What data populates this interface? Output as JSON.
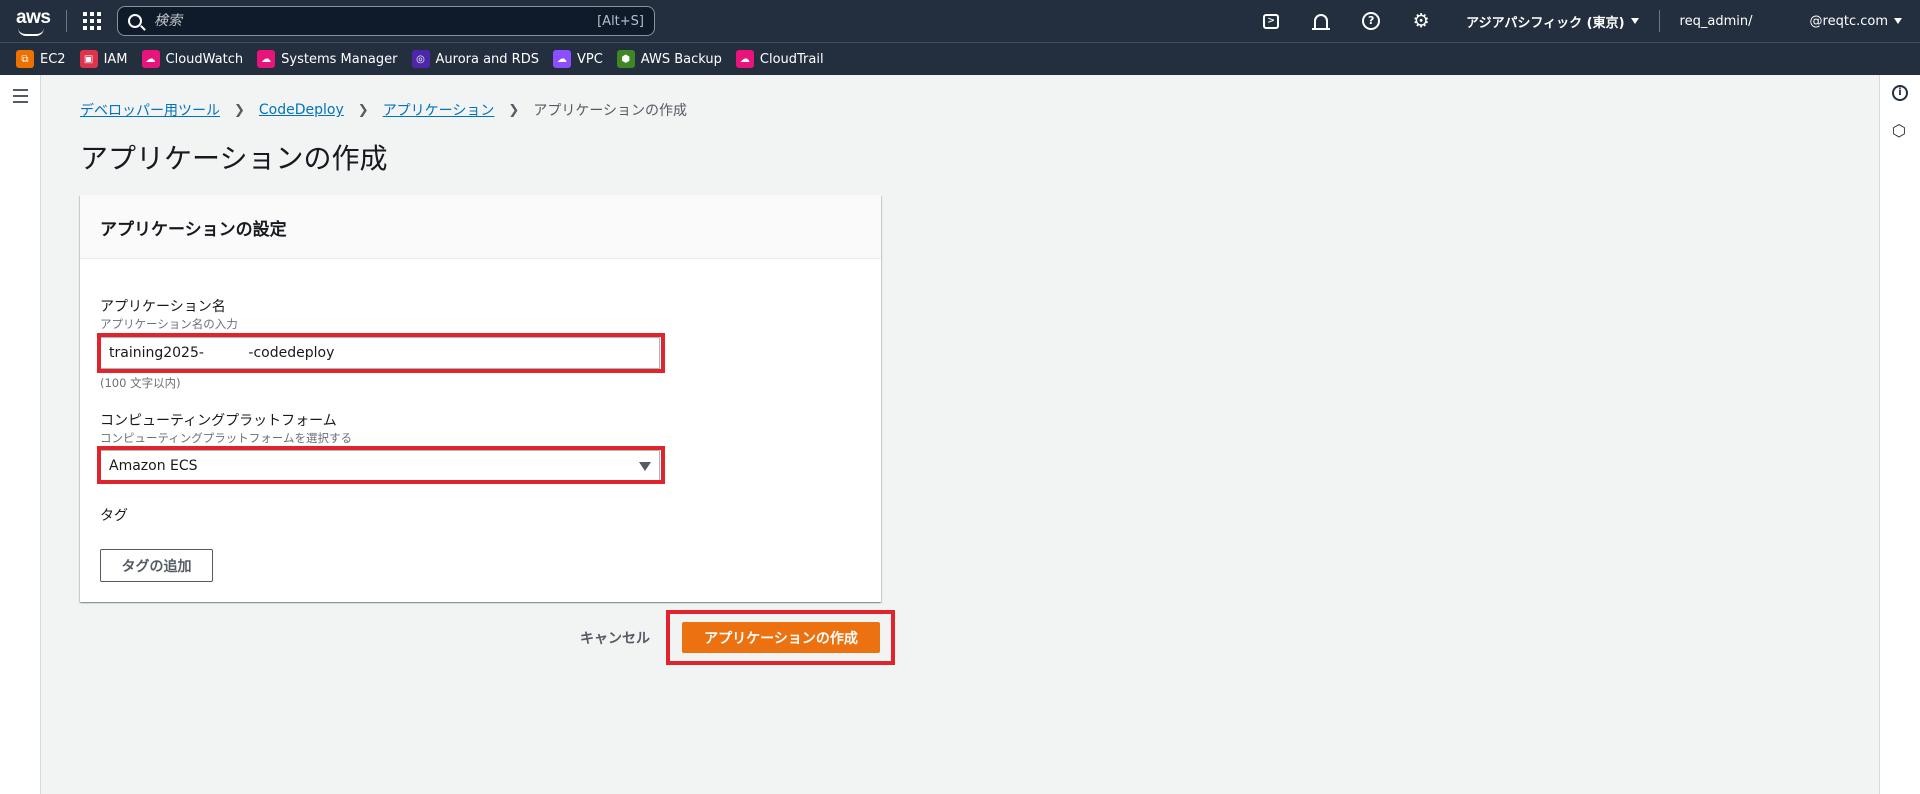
{
  "topnav": {
    "logo": "aws",
    "search_placeholder": "検索",
    "search_shortcut": "[Alt+S]",
    "region": "アジアパシフィック (東京)",
    "user": "req_admin/",
    "account": "@reqtc.com",
    "icons": [
      "cloudshell-icon",
      "bell-icon",
      "help-icon",
      "gear-icon"
    ]
  },
  "favorites": [
    {
      "label": "EC2",
      "color": "#ed7100"
    },
    {
      "label": "IAM",
      "color": "#dd344c"
    },
    {
      "label": "CloudWatch",
      "color": "#e7157b"
    },
    {
      "label": "Systems Manager",
      "color": "#e7157b"
    },
    {
      "label": "Aurora and RDS",
      "color": "#4d27aa"
    },
    {
      "label": "VPC",
      "color": "#8c4fff"
    },
    {
      "label": "AWS Backup",
      "color": "#3f8624"
    },
    {
      "label": "CloudTrail",
      "color": "#e7157b"
    }
  ],
  "breadcrumb": {
    "items": [
      "デベロッパー用ツール",
      "CodeDeploy",
      "アプリケーション"
    ],
    "current": "アプリケーションの作成"
  },
  "page": {
    "title": "アプリケーションの作成"
  },
  "panel": {
    "title": "アプリケーションの設定",
    "app_name": {
      "label": "アプリケーション名",
      "description": "アプリケーション名の入力",
      "value": "training2025-          -codedeploy",
      "hint": "(100 文字以内)"
    },
    "platform": {
      "label": "コンピューティングプラットフォーム",
      "description": "コンピューティングプラットフォームを選択する",
      "value": "Amazon ECS"
    },
    "tags": {
      "label": "タグ",
      "add_button": "タグの追加"
    }
  },
  "actions": {
    "cancel": "キャンセル",
    "create": "アプリケーションの作成"
  },
  "colors": {
    "primary": "#ec7211",
    "highlight": "#e0242c",
    "link": "#0073bb",
    "nav_bg": "#232f3e"
  }
}
